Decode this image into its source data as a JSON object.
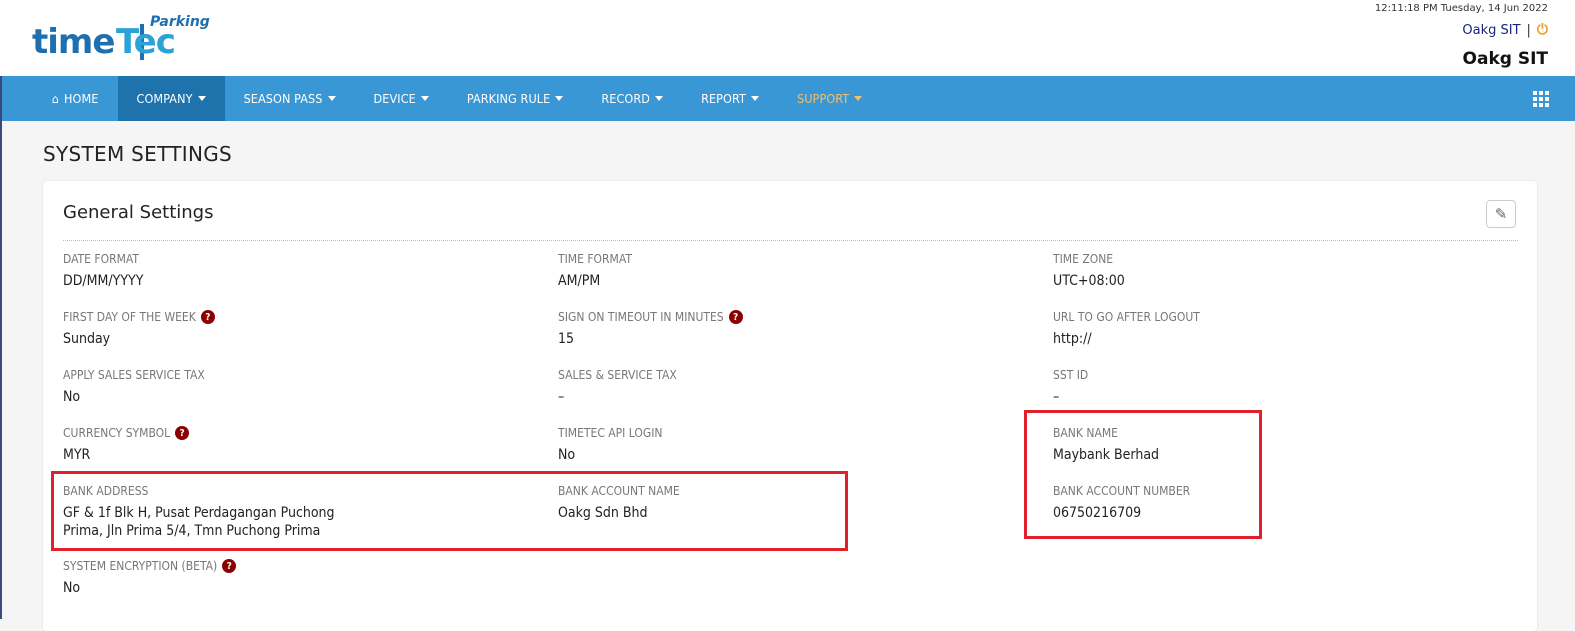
{
  "header": {
    "logo": {
      "time": "time",
      "tec": "Tec",
      "parking": "Parking"
    },
    "datetime": "12:11:18 PM Tuesday, 14 Jun 2022",
    "user_name": "Oakg SIT",
    "separator": "|",
    "company_name": "Oakg SIT",
    "power_icon": "power-icon"
  },
  "nav": {
    "items": [
      {
        "label": "HOME",
        "icon": "home-icon"
      },
      {
        "label": "COMPANY"
      },
      {
        "label": "SEASON PASS"
      },
      {
        "label": "DEVICE"
      },
      {
        "label": "PARKING RULE"
      },
      {
        "label": "RECORD"
      },
      {
        "label": "REPORT"
      },
      {
        "label": "SUPPORT"
      }
    ],
    "colors": {
      "bar": "#3a97d6",
      "active": "#1f73ad",
      "support": "#f0c070"
    }
  },
  "page_title": "SYSTEM SETTINGS",
  "card": {
    "title": "General Settings",
    "edit_icon": "pencil-icon",
    "fields": {
      "date_format": {
        "label": "DATE FORMAT",
        "value": "DD/MM/YYYY"
      },
      "time_format": {
        "label": "TIME FORMAT",
        "value": "AM/PM"
      },
      "time_zone": {
        "label": "TIME ZONE",
        "value": "UTC+08:00"
      },
      "first_day": {
        "label": "FIRST DAY OF THE WEEK",
        "value": "Sunday"
      },
      "sign_on_timeout": {
        "label": "SIGN ON TIMEOUT IN MINUTES",
        "value": "15"
      },
      "logout_url": {
        "label": "URL TO GO AFTER LOGOUT",
        "value": "http://"
      },
      "apply_sst": {
        "label": "APPLY SALES SERVICE TAX",
        "value": "No"
      },
      "sst": {
        "label": "SALES & SERVICE TAX",
        "value": "–"
      },
      "sst_id": {
        "label": "SST ID",
        "value": "–"
      },
      "currency": {
        "label": "CURRENCY SYMBOL",
        "value": "MYR"
      },
      "api_login": {
        "label": "TIMETEC API LOGIN",
        "value": "No"
      },
      "bank_name": {
        "label": "BANK NAME",
        "value": "Maybank Berhad"
      },
      "bank_address": {
        "label": "BANK ADDRESS",
        "value_line1": "GF & 1f Blk H, Pusat Perdagangan Puchong",
        "value_line2": "Prima, Jln Prima 5/4, Tmn Puchong Prima"
      },
      "bank_account_name": {
        "label": "BANK ACCOUNT NAME",
        "value": "Oakg Sdn Bhd"
      },
      "bank_account_number": {
        "label": "BANK ACCOUNT NUMBER",
        "value": "06750216709"
      },
      "encryption": {
        "label": "SYSTEM ENCRYPTION (BETA)",
        "value": "No"
      }
    },
    "help_icon": "question-icon",
    "highlight_color": "#e0202a"
  }
}
